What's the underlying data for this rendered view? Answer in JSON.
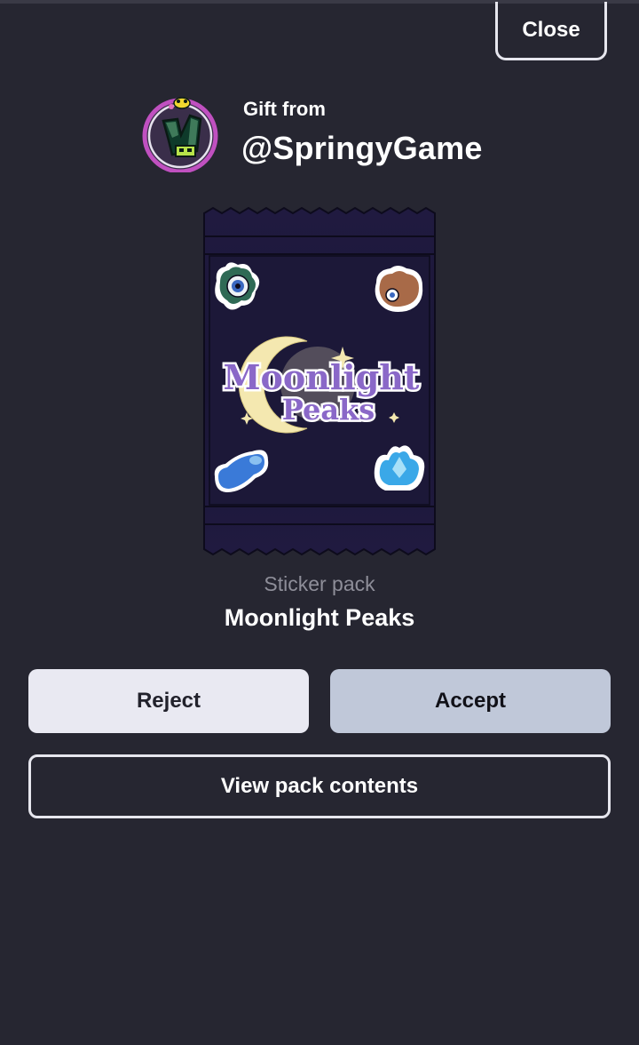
{
  "header": {
    "close_label": "Close"
  },
  "gift": {
    "from_label": "Gift from",
    "sender": "@SpringyGame"
  },
  "pack": {
    "type_label": "Sticker pack",
    "name": "Moonlight Peaks",
    "logo_line1": "Moonlight",
    "logo_line2": "Peaks"
  },
  "actions": {
    "reject_label": "Reject",
    "accept_label": "Accept",
    "view_contents_label": "View pack contents"
  },
  "colors": {
    "background": "#262631",
    "reject_bg": "#e9e9f2",
    "accept_bg": "#c0c8d9",
    "pack_bg": "#1c1838",
    "avatar_ring": "#c050c0"
  }
}
